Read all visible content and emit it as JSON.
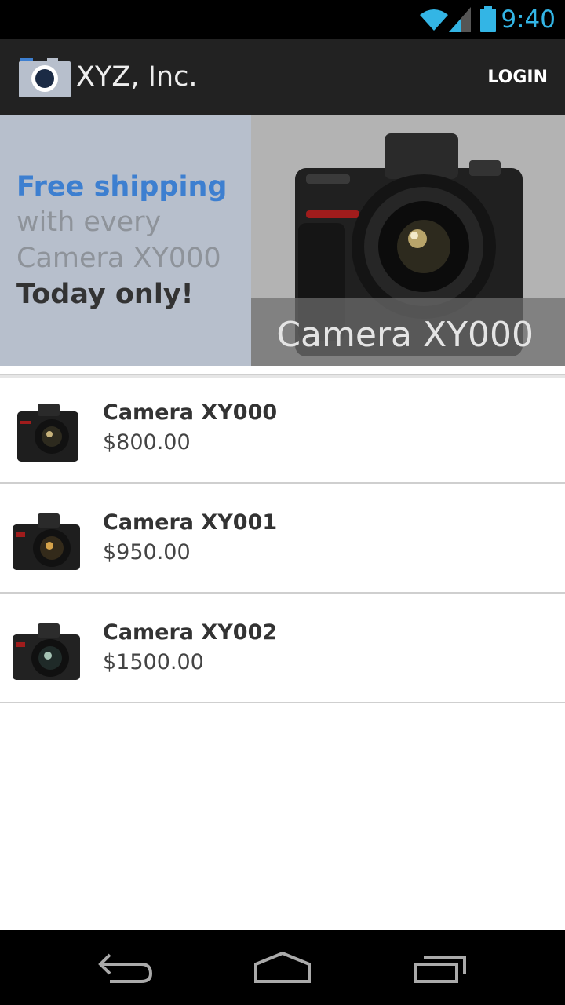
{
  "status_bar": {
    "time": "9:40",
    "icons": [
      "wifi-icon",
      "signal-icon",
      "battery-icon"
    ],
    "accent_color": "#33b5e5"
  },
  "action_bar": {
    "title": "XYZ, Inc.",
    "login_label": "LOGIN",
    "icon": "camera-icon"
  },
  "promo": {
    "line1": "Free shipping",
    "line2": "with every",
    "line3": "Camera XY000",
    "line4": "Today only!",
    "caption": "Camera XY000",
    "highlight_color": "#3d7fd0"
  },
  "products": [
    {
      "name": "Camera XY000",
      "price": "$800.00"
    },
    {
      "name": "Camera XY001",
      "price": "$950.00"
    },
    {
      "name": "Camera XY002",
      "price": "$1500.00"
    }
  ],
  "nav_bar": {
    "icons": [
      "back-icon",
      "home-icon",
      "recents-icon"
    ]
  }
}
